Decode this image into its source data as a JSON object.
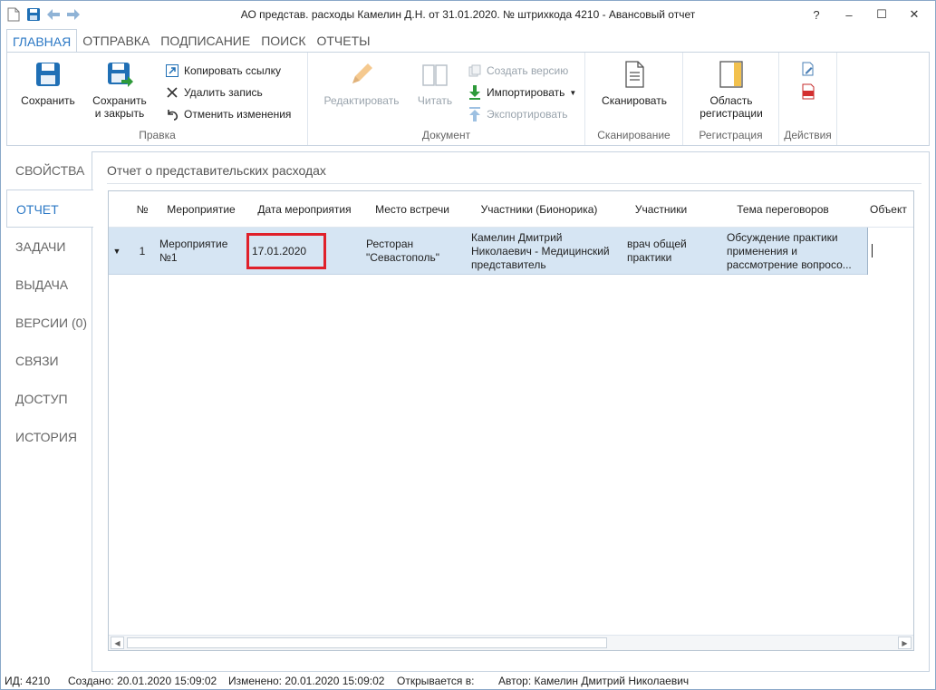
{
  "window": {
    "title": "АО представ. расходы Камелин Д.Н. от 31.01.2020. № штрихкода 4210 - Авансовый отчет",
    "help": "?",
    "minimize": "–",
    "maximize": "☐",
    "close": "✕"
  },
  "ribbon_tabs": [
    "ГЛАВНАЯ",
    "ОТПРАВКА",
    "ПОДПИСАНИЕ",
    "ПОИСК",
    "ОТЧЕТЫ"
  ],
  "ribbon": {
    "pravka": {
      "label": "Правка",
      "save": "Сохранить",
      "save_close_1": "Сохранить",
      "save_close_2": "и закрыть",
      "copy_link": "Копировать ссылку",
      "delete_record": "Удалить запись",
      "undo_changes": "Отменить изменения"
    },
    "document": {
      "label": "Документ",
      "edit": "Редактировать",
      "read": "Читать",
      "create_version": "Создать версию",
      "import": "Импортировать",
      "export": "Экспортировать"
    },
    "scan": {
      "label": "Сканирование",
      "scan": "Сканировать"
    },
    "registration": {
      "label": "Регистрация",
      "area_1": "Область",
      "area_2": "регистрации"
    },
    "actions": {
      "label": "Действия"
    }
  },
  "nav": [
    "СВОЙСТВА",
    "ОТЧЕТ",
    "ЗАДАЧИ",
    "ВЫДАЧА",
    "ВЕРСИИ (0)",
    "СВЯЗИ",
    "ДОСТУП",
    "ИСТОРИЯ"
  ],
  "section_title": "Отчет о представительских расходах",
  "grid": {
    "headers": [
      "№",
      "Мероприятие",
      "Дата мероприятия",
      "Место встречи",
      "Участники (Бионорика)",
      "Участники",
      "Тема переговоров",
      "Объект"
    ],
    "row": {
      "num": "1",
      "event_1": "Мероприятие",
      "event_2": "№1",
      "date": "17.01.2020",
      "place_1": "Ресторан",
      "place_2": "\"Севастополь\"",
      "bion_1": "Камелин Дмитрий",
      "bion_2": "Николаевич - Медицинский",
      "bion_3": "представитель",
      "part_1": "врач общей",
      "part_2": "практики",
      "topic_1": "Обсуждение практики",
      "topic_2": "применения и",
      "topic_3": "рассмотрение  вопросо..."
    }
  },
  "status": {
    "id": "ИД: 4210",
    "created": "Создано: 20.01.2020 15:09:02",
    "modified": "Изменено: 20.01.2020 15:09:02",
    "opens": "Открывается в:",
    "author": "Автор: Камелин Дмитрий Николаевич"
  },
  "colors": {
    "accent": "#2b78c5",
    "selection": "#d6e5f3",
    "highlight": "#e0202a",
    "import_green": "#2e9a3a"
  }
}
